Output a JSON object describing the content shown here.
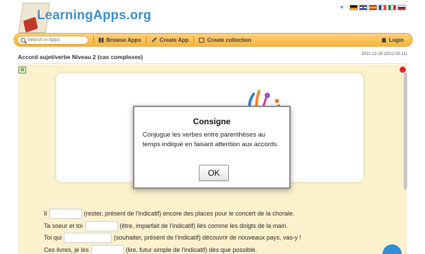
{
  "header": {
    "logo_text": "LearningApps.org",
    "languages": [
      "de",
      "en",
      "es",
      "fr",
      "it",
      "ru"
    ]
  },
  "navbar": {
    "search_placeholder": "Search in Apps",
    "browse_label": "Browse Apps",
    "create_label": "Create App",
    "collection_label": "Create collection",
    "login_label": "Login"
  },
  "app": {
    "title": "Accord sujet/verbe Niveau 2 (cas complexes)",
    "date": "2021-12-28 (2012-05-11)"
  },
  "exercise": {
    "lines": [
      {
        "before": "Il",
        "after": "(rester, présent de l'indicatif) encore des places pour le concert de la chorale."
      },
      {
        "before": "Ta soeur et toi",
        "after": "(être, imparfait de l'indicatif) liés comme les doigts de la main."
      },
      {
        "before": "Toi qui",
        "after": "(souhaiter, présent de l'indicatif) découvrir de nouveaux pays, vas-y !"
      },
      {
        "before": "Ces livres, je les",
        "after": "(lire, futur simple de l'indicatif) dès que possible."
      }
    ]
  },
  "modal": {
    "title": "Consigne",
    "text": "Conjugue les verbes entre parenthèses au temps indiqué en faisant attention aux accords.",
    "ok_label": "OK"
  },
  "colors": {
    "accent": "#f4b63f",
    "app_background": "#fbf1cd",
    "logo_blue": "#3a8fd0"
  }
}
